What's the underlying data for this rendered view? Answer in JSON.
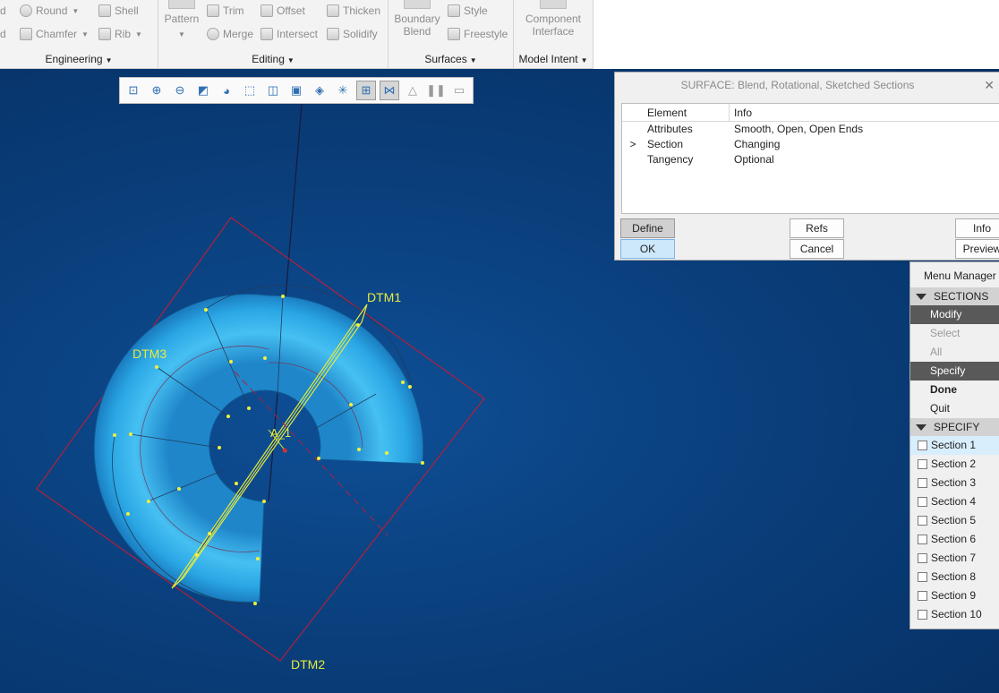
{
  "ribbon": {
    "engineering": {
      "label": "Engineering",
      "items": [
        "Round",
        "Chamfer",
        "Shell",
        "Rib"
      ],
      "partial_left": [
        "d",
        "d"
      ]
    },
    "editing": {
      "label": "Editing",
      "pattern": "Pattern",
      "items": [
        "Trim",
        "Offset",
        "Thicken",
        "Merge",
        "Intersect",
        "Solidify"
      ]
    },
    "surfaces": {
      "label": "Surfaces",
      "boundary_blend": [
        "Boundary",
        "Blend"
      ],
      "items": [
        "Style",
        "Freestyle"
      ]
    },
    "model_intent": {
      "label": "Model Intent",
      "component_interface": [
        "Component",
        "Interface"
      ]
    }
  },
  "viewport": {
    "datum_labels": [
      "DTM1",
      "DTM2",
      "DTM3",
      "A_1"
    ]
  },
  "graphics_toolbar": {
    "icons": [
      "refit-icon",
      "zoom-in-icon",
      "zoom-out-icon",
      "repaint-icon",
      "display-style-icon",
      "saved-orientations-icon",
      "view-manager-icon",
      "perspective-icon",
      "spin-center-icon",
      "datum-display-icon",
      "annotation-display-icon",
      "csys-display-icon",
      "simulation-icon",
      "pause-icon",
      "end-icon"
    ]
  },
  "dialog": {
    "title": "SURFACE: Blend, Rotational, Sketched Sections",
    "columns": [
      "Element",
      "Info"
    ],
    "rows": [
      {
        "marker": "",
        "element": "Attributes",
        "info": "Smooth, Open, Open Ends"
      },
      {
        "marker": ">",
        "element": "Section",
        "info": "Changing"
      },
      {
        "marker": "",
        "element": "Tangency",
        "info": "Optional"
      }
    ],
    "buttons": {
      "define": "Define",
      "ok": "OK",
      "refs": "Refs",
      "cancel": "Cancel",
      "info": "Info",
      "preview": "Preview"
    }
  },
  "menu_manager": {
    "title": "Menu Manager",
    "sections_header": "SECTIONS",
    "sections_items": [
      {
        "label": "Modify",
        "state": "selected"
      },
      {
        "label": "Select",
        "state": "disabled"
      },
      {
        "label": "All",
        "state": "disabled"
      },
      {
        "label": "Specify",
        "state": "selected"
      },
      {
        "label": "Done",
        "state": "bold"
      },
      {
        "label": "Quit",
        "state": "normal"
      }
    ],
    "specify_header": "SPECIFY",
    "specify_items": [
      "Section 1",
      "Section 2",
      "Section 3",
      "Section 4",
      "Section 5",
      "Section 6",
      "Section 7",
      "Section 8",
      "Section 9",
      "Section 10"
    ]
  }
}
